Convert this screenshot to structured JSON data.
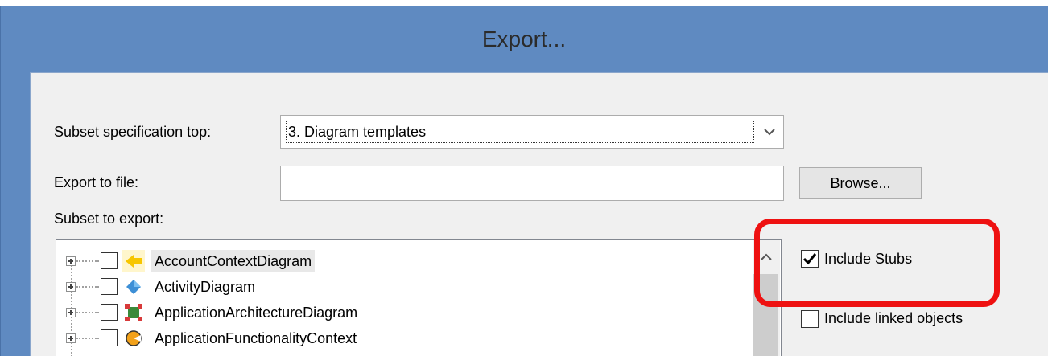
{
  "dialog": {
    "title": "Export..."
  },
  "form": {
    "subset_spec_label": "Subset specification top:",
    "subset_spec_value": "3. Diagram templates",
    "export_file_label": "Export to file:",
    "export_file_value": "",
    "browse_label": "Browse...",
    "subset_to_export_label": "Subset to export:"
  },
  "tree": {
    "items": [
      {
        "label": "AccountContextDiagram",
        "icon": "account-context-icon",
        "checked": false,
        "selected": true
      },
      {
        "label": "ActivityDiagram",
        "icon": "activity-diamond-icon",
        "checked": false,
        "selected": false
      },
      {
        "label": "ApplicationArchitectureDiagram",
        "icon": "application-architecture-icon",
        "checked": false,
        "selected": false
      },
      {
        "label": "ApplicationFunctionalityContext",
        "icon": "application-functionality-icon",
        "checked": false,
        "selected": false
      }
    ]
  },
  "options": {
    "include_stubs_label": "Include Stubs",
    "include_stubs_checked": true,
    "include_linked_label": "Include linked objects",
    "include_linked_checked": false
  },
  "annotation": {
    "highlight_color": "#ee1111"
  },
  "colors": {
    "title_bar": "#5f8ac1",
    "client_bg": "#f0f0f0"
  }
}
